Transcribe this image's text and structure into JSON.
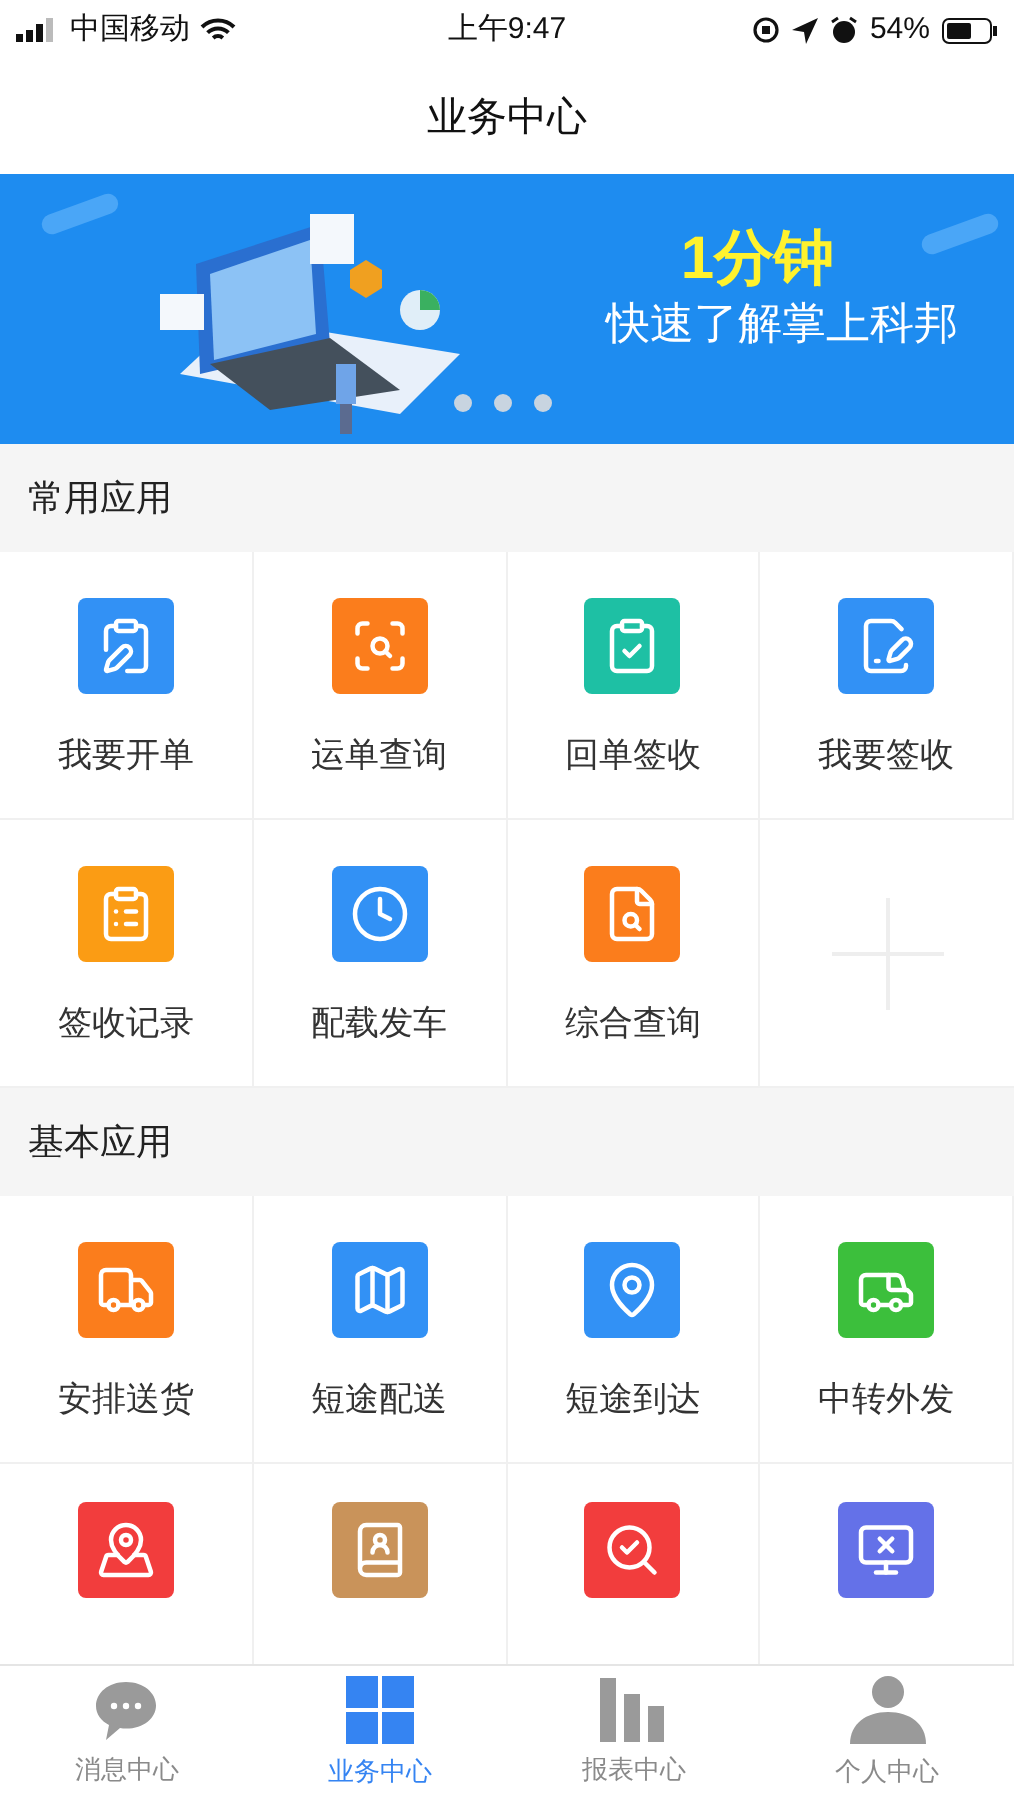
{
  "status_bar": {
    "carrier": "中国移动",
    "time": "上午9:47",
    "battery": "54%"
  },
  "title": "业务中心",
  "banner": {
    "headline": "1分钟",
    "subtitle": "快速了解掌上科邦"
  },
  "sections": [
    {
      "title": "常用应用",
      "items": [
        {
          "kind": "app",
          "label": "我要开单",
          "color": "#3291f5"
        },
        {
          "kind": "app",
          "label": "运单查询",
          "color": "#fb7d1c"
        },
        {
          "kind": "app",
          "label": "回单签收",
          "color": "#1ec0a4"
        },
        {
          "kind": "app",
          "label": "我要签收",
          "color": "#3291f5"
        },
        {
          "kind": "app",
          "label": "签收记录",
          "color": "#fb9c14"
        },
        {
          "kind": "app",
          "label": "配载发车",
          "color": "#3291f5"
        },
        {
          "kind": "app",
          "label": "综合查询",
          "color": "#fb7d1c"
        },
        {
          "kind": "add"
        }
      ]
    },
    {
      "title": "基本应用",
      "items": [
        {
          "kind": "app",
          "label": "安排送货",
          "color": "#fb7d1c"
        },
        {
          "kind": "app",
          "label": "短途配送",
          "color": "#3291f5"
        },
        {
          "kind": "app",
          "label": "短途到达",
          "color": "#3291f5"
        },
        {
          "kind": "app",
          "label": "中转外发",
          "color": "#3cbf3c"
        },
        {
          "kind": "app-cut",
          "color": "#f23d3d"
        },
        {
          "kind": "app-cut",
          "color": "#c9935a"
        },
        {
          "kind": "app-cut",
          "color": "#f23d3d"
        },
        {
          "kind": "app-cut",
          "color": "#6471e8"
        }
      ]
    }
  ],
  "tabs": [
    {
      "label": "消息中心",
      "selected": false
    },
    {
      "label": "业务中心",
      "selected": true
    },
    {
      "label": "报表中心",
      "selected": false
    },
    {
      "label": "个人中心",
      "selected": false
    }
  ]
}
